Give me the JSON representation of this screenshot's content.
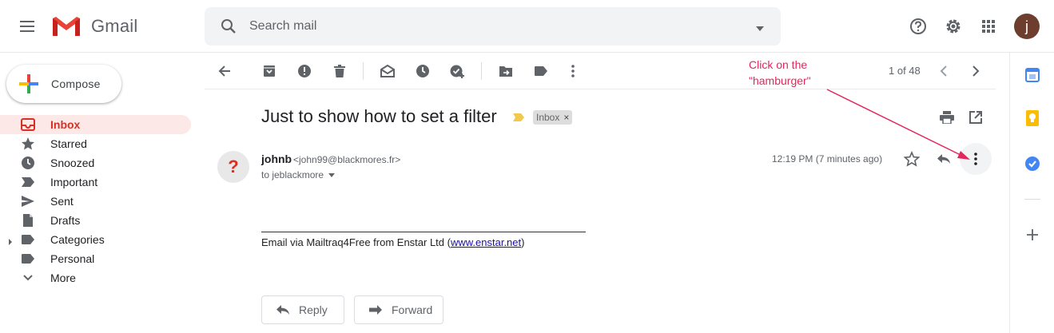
{
  "header": {
    "app_name": "Gmail",
    "search_placeholder": "Search mail",
    "avatar_initial": "j"
  },
  "compose": {
    "label": "Compose"
  },
  "sidebar": {
    "items": [
      {
        "label": "Inbox",
        "icon": "inbox-icon",
        "active": true
      },
      {
        "label": "Starred",
        "icon": "star-icon"
      },
      {
        "label": "Snoozed",
        "icon": "clock-icon"
      },
      {
        "label": "Important",
        "icon": "important-icon"
      },
      {
        "label": "Sent",
        "icon": "send-icon"
      },
      {
        "label": "Drafts",
        "icon": "draft-icon"
      },
      {
        "label": "Categories",
        "icon": "label-icon"
      },
      {
        "label": "Personal",
        "icon": "label-icon"
      },
      {
        "label": "More",
        "icon": "chevron-down-icon"
      }
    ]
  },
  "toolbar": {
    "pager": "1 of 48"
  },
  "annotation": {
    "line1": "Click on the",
    "line2": "\"hamburger\""
  },
  "message": {
    "subject": "Just to show how to set a filter",
    "label_chip": "Inbox",
    "label_chip_close": "×",
    "sender_name": "johnb",
    "sender_email": "<john99@blackmores.fr>",
    "recipient": "to jeblackmore",
    "timestamp": "12:19 PM (7 minutes ago)",
    "body_prefix": "Email via Mailtraq4Free from Enstar Ltd (",
    "body_link": "www.enstar.net",
    "body_suffix": ")",
    "sender_avatar": "?"
  },
  "actions": {
    "reply_label": "Reply",
    "forward_label": "Forward"
  },
  "colors": {
    "accent_red": "#d93025",
    "annotation": "#e5265c"
  }
}
